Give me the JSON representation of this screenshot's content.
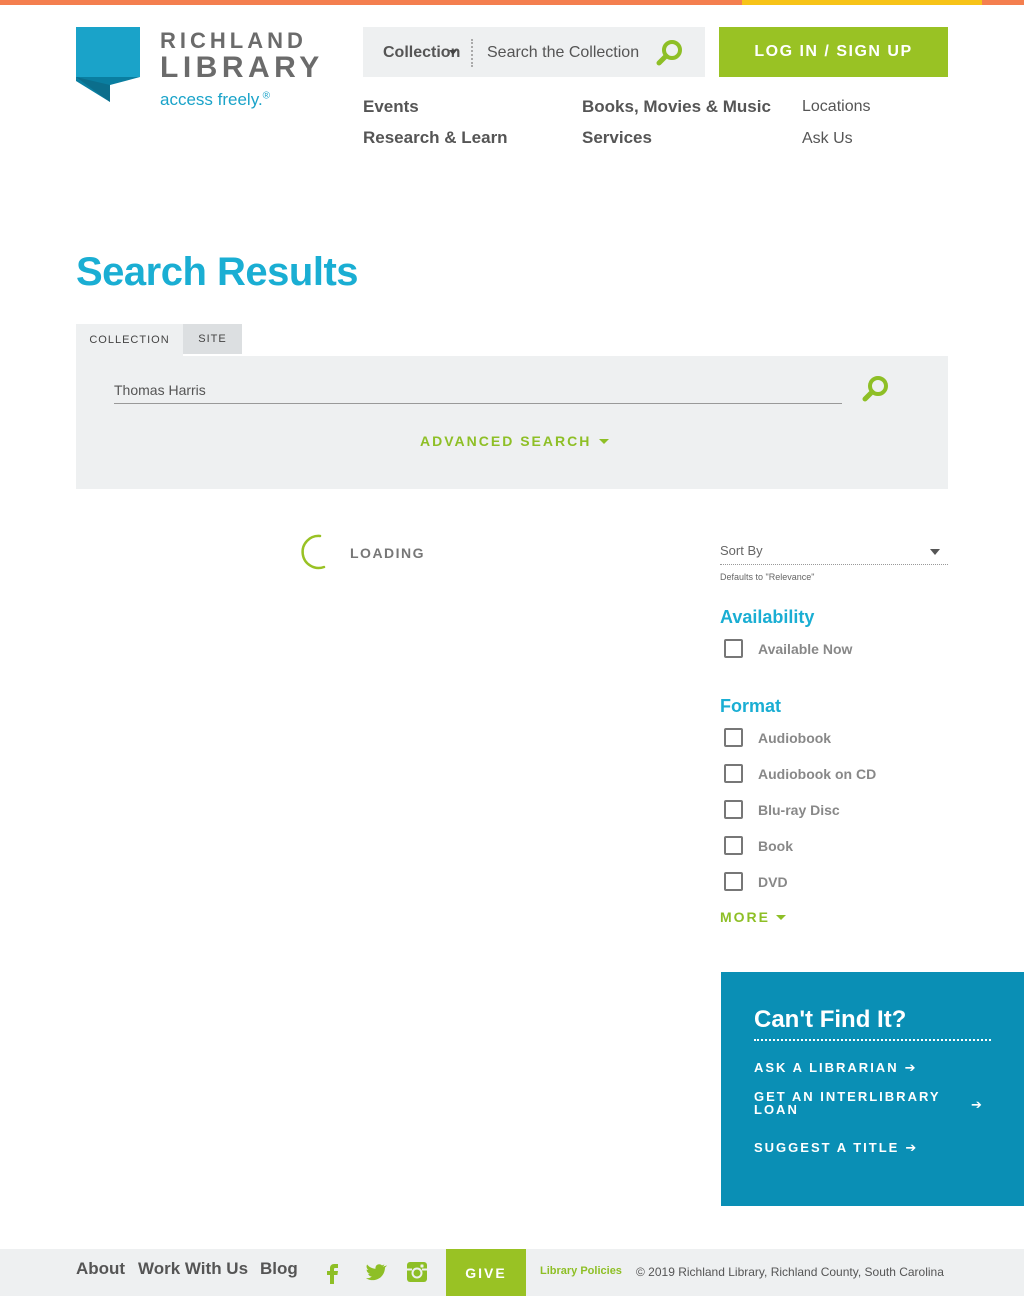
{
  "brand": {
    "name_line1": "RICHLAND",
    "name_line2": "LIBRARY",
    "tagline": "access freely.",
    "tagline_mark": "®",
    "colors": {
      "teal": "#1aaed3",
      "green": "#99c224",
      "orange": "#f47f4f",
      "yellow": "#f7c318",
      "panel_blue": "#0a8fb5"
    }
  },
  "header": {
    "search_scope": "Collection",
    "search_placeholder": "Search the Collection",
    "login_label": "LOG IN / SIGN UP"
  },
  "nav": {
    "events": "Events",
    "books": "Books, Movies & Music",
    "locations": "Locations",
    "research": "Research & Learn",
    "services": "Services",
    "ask": "Ask Us"
  },
  "page": {
    "title": "Search Results",
    "tabs": {
      "collection": "COLLECTION",
      "site": "SITE"
    },
    "query": "Thomas Harris",
    "advanced_label": "ADVANCED SEARCH",
    "loading_label": "LOADING"
  },
  "filters": {
    "sort_label": "Sort By",
    "sort_note": "Defaults to \"Relevance\"",
    "availability_heading": "Availability",
    "availability_options": [
      "Available Now"
    ],
    "format_heading": "Format",
    "format_options": [
      "Audiobook",
      "Audiobook on CD",
      "Blu-ray Disc",
      "Book",
      "DVD"
    ],
    "more_label": "MORE"
  },
  "cant_find": {
    "heading": "Can't Find It?",
    "ask": "ASK A LIBRARIAN",
    "ill_line1": "GET AN INTERLIBRARY",
    "ill_line2": "LOAN",
    "suggest": "SUGGEST A TITLE",
    "arrow": "➔"
  },
  "footer": {
    "about": "About",
    "work": "Work With Us",
    "blog": "Blog",
    "icons": [
      "facebook-icon",
      "twitter-icon",
      "instagram-icon"
    ],
    "give": "GIVE",
    "policies": "Library Policies",
    "copyright": "© 2019 Richland Library, Richland County, South Carolina"
  }
}
